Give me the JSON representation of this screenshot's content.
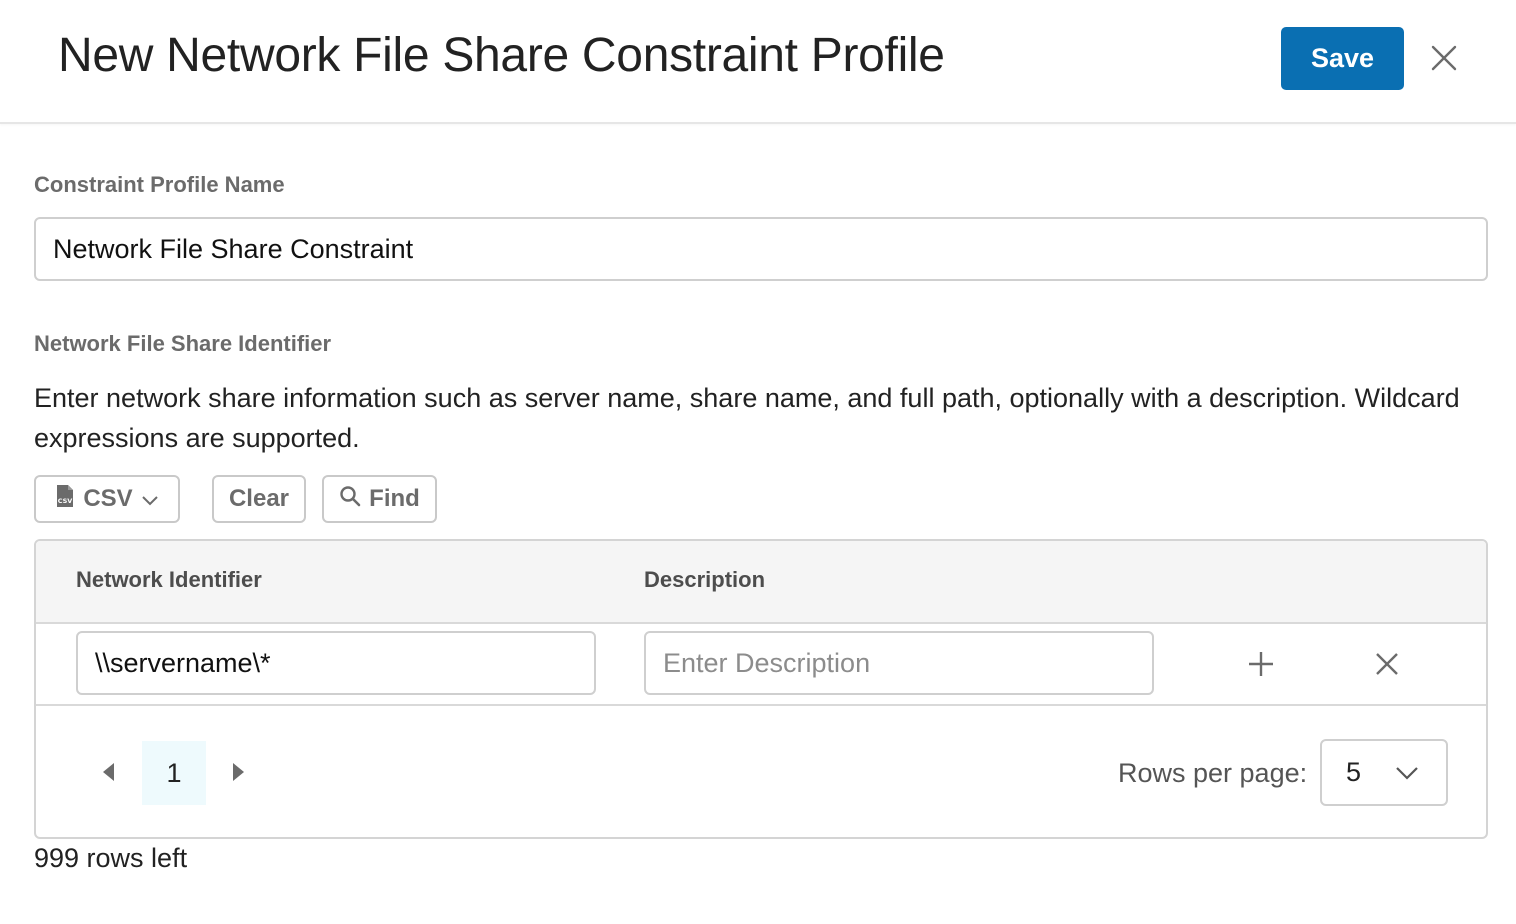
{
  "header": {
    "title": "New Network File Share Constraint Profile",
    "save_label": "Save",
    "close_icon": "close-icon"
  },
  "profile_name": {
    "label": "Constraint Profile Name",
    "value": "Network File Share Constraint"
  },
  "identifier_section": {
    "label": "Network File Share Identifier",
    "description": "Enter network share information such as server name, share name, and full path, optionally with a description. Wildcard expressions are supported."
  },
  "toolbar": {
    "csv_label": "CSV",
    "clear_label": "Clear",
    "find_label": "Find"
  },
  "table": {
    "columns": [
      "Network Identifier",
      "Description"
    ],
    "rows": [
      {
        "identifier": "\\\\servername\\*",
        "description": "",
        "description_placeholder": "Enter Description"
      }
    ]
  },
  "pagination": {
    "current_page": "1",
    "rows_per_page_label": "Rows per page:",
    "rows_per_page_value": "5"
  },
  "footer": {
    "rows_left": "999 rows left"
  },
  "colors": {
    "accent": "#0a6fb2",
    "page_highlight": "#eefafd"
  }
}
